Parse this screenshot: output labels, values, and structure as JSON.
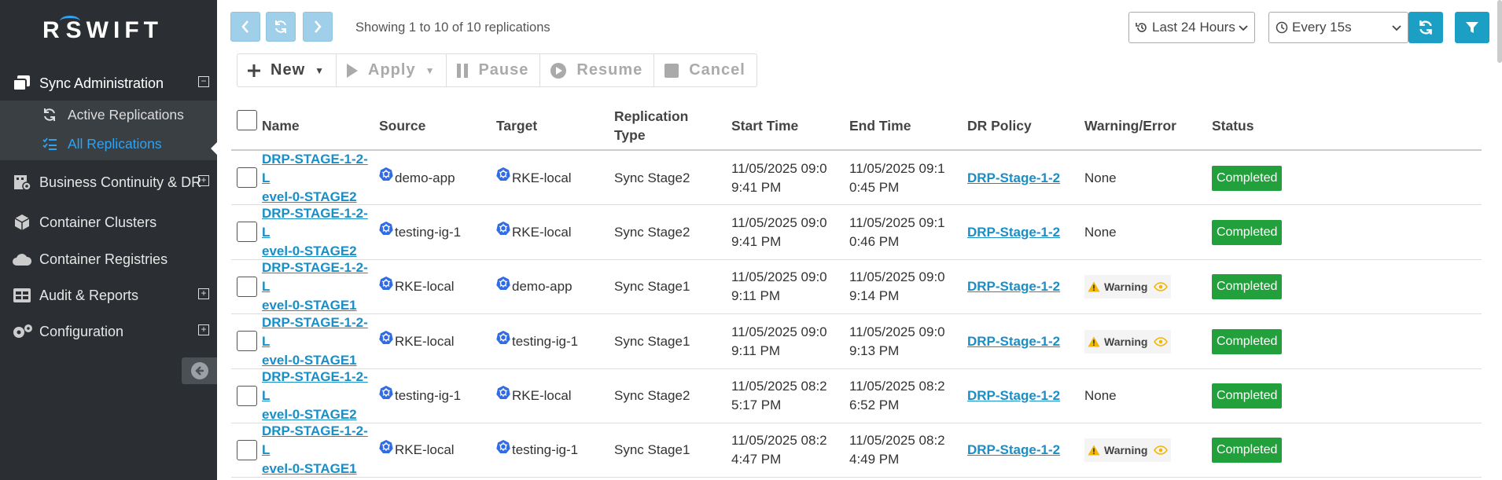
{
  "app": {
    "logo_r": "R",
    "logo_rest": "SWIFT"
  },
  "sidebar": {
    "items": [
      {
        "label": "Sync Administration",
        "icon": "copy-icon"
      },
      {
        "label": "Business Continuity & DR",
        "icon": "building-gear-icon"
      },
      {
        "label": "Container Clusters",
        "icon": "cube-icon"
      },
      {
        "label": "Container Registries",
        "icon": "cloud-icon"
      },
      {
        "label": "Audit & Reports",
        "icon": "table-icon"
      },
      {
        "label": "Configuration",
        "icon": "gears-icon"
      }
    ],
    "subitems": [
      {
        "label": "Active Replications",
        "icon": "sync-icon"
      },
      {
        "label": "All Replications",
        "icon": "list-check-icon"
      }
    ]
  },
  "topbar": {
    "showing": "Showing 1 to 10 of 10 replications",
    "range": "Last 24 Hours",
    "refresh_interval": "Every 15s"
  },
  "toolbar": {
    "new": "New",
    "apply": "Apply",
    "pause": "Pause",
    "resume": "Resume",
    "cancel": "Cancel"
  },
  "table": {
    "headers": [
      "Name",
      "Source",
      "Target",
      "Replication Type",
      "Start Time",
      "End Time",
      "DR Policy",
      "Warning/Error",
      "Status"
    ],
    "rows": [
      {
        "name": "DRP-STAGE-1-2-Level-0-STAGE2",
        "name_l1": "DRP-STAGE-1-2-L",
        "name_l2": "evel-0-STAGE2",
        "source": "demo-app",
        "target": "RKE-local",
        "type": "Sync Stage2",
        "start_l1": "11/05/2025 09:0",
        "start_l2": "9:41 PM",
        "end_l1": "11/05/2025 09:1",
        "end_l2": "0:45 PM",
        "policy": "DRP-Stage-1-2",
        "warning": "None",
        "status": "Completed"
      },
      {
        "name": "DRP-STAGE-1-2-Level-0-STAGE2",
        "name_l1": "DRP-STAGE-1-2-L",
        "name_l2": "evel-0-STAGE2",
        "source": "testing-ig-1",
        "target": "RKE-local",
        "type": "Sync Stage2",
        "start_l1": "11/05/2025 09:0",
        "start_l2": "9:41 PM",
        "end_l1": "11/05/2025 09:1",
        "end_l2": "0:46 PM",
        "policy": "DRP-Stage-1-2",
        "warning": "None",
        "status": "Completed"
      },
      {
        "name": "DRP-STAGE-1-2-Level-0-STAGE1",
        "name_l1": "DRP-STAGE-1-2-L",
        "name_l2": "evel-0-STAGE1",
        "source": "RKE-local",
        "target": "demo-app",
        "type": "Sync Stage1",
        "start_l1": "11/05/2025 09:0",
        "start_l2": "9:11 PM",
        "end_l1": "11/05/2025 09:0",
        "end_l2": "9:14 PM",
        "policy": "DRP-Stage-1-2",
        "warning": "Warning",
        "status": "Completed"
      },
      {
        "name": "DRP-STAGE-1-2-Level-0-STAGE1",
        "name_l1": "DRP-STAGE-1-2-L",
        "name_l2": "evel-0-STAGE1",
        "source": "RKE-local",
        "target": "testing-ig-1",
        "type": "Sync Stage1",
        "start_l1": "11/05/2025 09:0",
        "start_l2": "9:11 PM",
        "end_l1": "11/05/2025 09:0",
        "end_l2": "9:13 PM",
        "policy": "DRP-Stage-1-2",
        "warning": "Warning",
        "status": "Completed"
      },
      {
        "name": "DRP-STAGE-1-2-Level-0-STAGE2",
        "name_l1": "DRP-STAGE-1-2-L",
        "name_l2": "evel-0-STAGE2",
        "source": "testing-ig-1",
        "target": "RKE-local",
        "type": "Sync Stage2",
        "start_l1": "11/05/2025 08:2",
        "start_l2": "5:17 PM",
        "end_l1": "11/05/2025 08:2",
        "end_l2": "6:52 PM",
        "policy": "DRP-Stage-1-2",
        "warning": "None",
        "status": "Completed"
      },
      {
        "name": "DRP-STAGE-1-2-Level-0-STAGE1",
        "name_l1": "DRP-STAGE-1-2-L",
        "name_l2": "evel-0-STAGE1",
        "source": "RKE-local",
        "target": "testing-ig-1",
        "type": "Sync Stage1",
        "start_l1": "11/05/2025 08:2",
        "start_l2": "4:47 PM",
        "end_l1": "11/05/2025 08:2",
        "end_l2": "4:49 PM",
        "policy": "DRP-Stage-1-2",
        "warning": "Warning",
        "status": "Completed"
      }
    ]
  },
  "colors": {
    "sidebar_bg": "#2b2f33",
    "accent": "#1b9fc4",
    "link": "#1a8ec7",
    "status_ok": "#22a03c",
    "warning": "#f2b705"
  }
}
